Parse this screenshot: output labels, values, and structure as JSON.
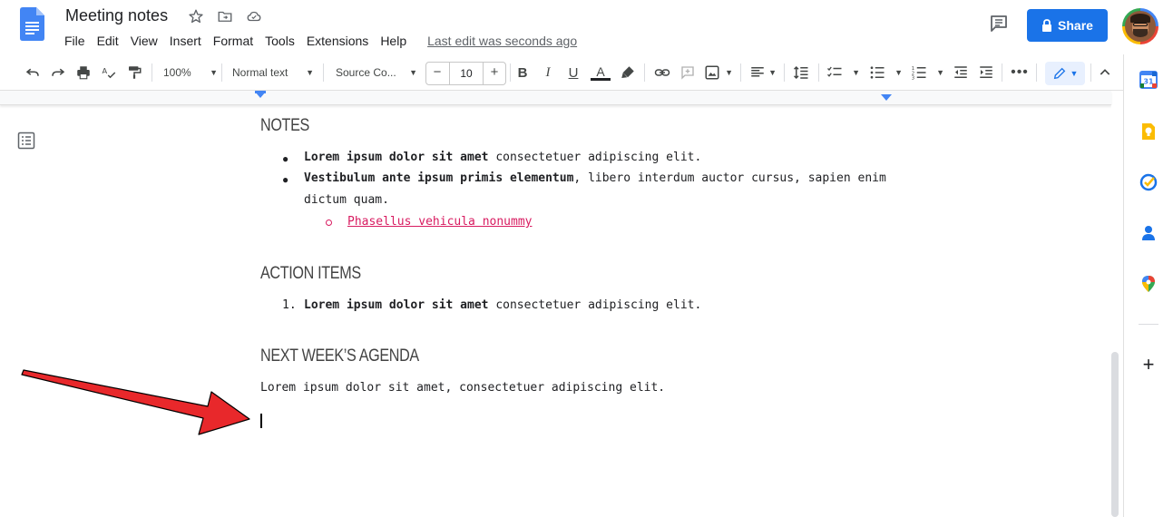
{
  "app": {
    "doc_title": "Meeting notes",
    "title_icons": [
      "star-icon",
      "move-to-folder-icon",
      "cloud-saved-icon"
    ],
    "menu": [
      "File",
      "Edit",
      "View",
      "Insert",
      "Format",
      "Tools",
      "Extensions",
      "Help"
    ],
    "last_edit": "Last edit was seconds ago",
    "share_label": "Share",
    "accent_color": "#1a73e8"
  },
  "toolbar": {
    "zoom": "100%",
    "style": "Normal text",
    "font": "Source Co...",
    "font_size": "10",
    "minus": "−",
    "plus": "+"
  },
  "document": {
    "notes_heading": "NOTES",
    "notes_item1_bold": "Lorem ipsum dolor sit amet",
    "notes_item1_rest": " consectetuer adipiscing elit.",
    "notes_item2_bold": "Vestibulum ante ipsum primis elementum",
    "notes_item2_rest": ", libero interdum auctor cursus, sapien enim",
    "notes_item2_line2": "dictum quam.",
    "notes_subitem_link": "Phasellus vehicula nonummy",
    "action_heading": "ACTION ITEMS",
    "action_item1_number": "1.",
    "action_item1_bold": "Lorem ipsum dolor sit amet",
    "action_item1_rest": " consectetuer adipiscing elit.",
    "agenda_heading": "NEXT WEEK’S AGENDA",
    "agenda_text": "Lorem ipsum dolor sit amet, consectetuer adipiscing elit.",
    "link_color": "#d81b60"
  },
  "side_panel": {
    "icons": [
      "calendar-icon",
      "keep-icon",
      "tasks-icon",
      "contacts-icon",
      "maps-icon"
    ],
    "calendar_day": "31",
    "add_label": "+"
  },
  "annotation": {
    "arrow_color": "#e8282b"
  }
}
